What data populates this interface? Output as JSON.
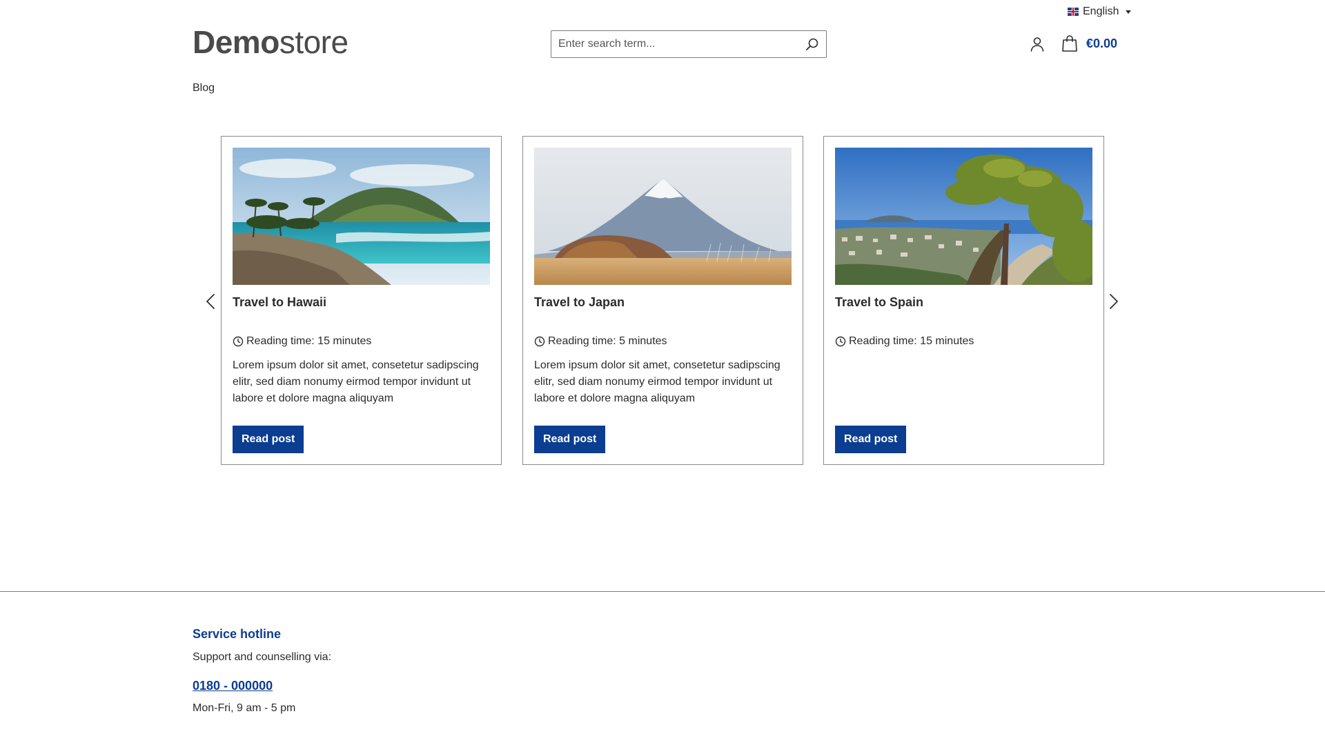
{
  "top_bar": {
    "language": "English"
  },
  "header": {
    "logo_bold": "Demo",
    "logo_light": "store",
    "search_placeholder": "Enter search term...",
    "cart_total": "€0.00"
  },
  "nav": {
    "blog": "Blog"
  },
  "posts": [
    {
      "title": "Travel to Hawaii",
      "reading_time": "Reading time: 15 minutes",
      "excerpt": "Lorem ipsum dolor sit amet, consetetur sadipscing elitr, sed diam nonumy eirmod tempor invidunt ut labore et dolore magna aliquyam",
      "button": "Read post"
    },
    {
      "title": "Travel to Japan",
      "reading_time": "Reading time: 5 minutes",
      "excerpt": "Lorem ipsum dolor sit amet, consetetur sadipscing elitr, sed diam nonumy eirmod tempor invidunt ut labore et dolore magna aliquyam",
      "button": "Read post"
    },
    {
      "title": "Travel to Spain",
      "reading_time": "Reading time: 15 minutes",
      "excerpt": "",
      "button": "Read post"
    }
  ],
  "footer": {
    "hotline_title": "Service hotline",
    "hotline_text": "Support and counselling via:",
    "phone": "0180 - 000000",
    "hours": "Mon-Fri, 9 am - 5 pm"
  },
  "colors": {
    "accent": "#0b3d91",
    "text": "#2b2b2b",
    "border": "#8a8a8a"
  },
  "icons": [
    "flag-uk-icon",
    "chevron-down-icon",
    "search-icon",
    "user-icon",
    "shopping-bag-icon",
    "chevron-left-icon",
    "chevron-right-icon",
    "clock-icon"
  ]
}
